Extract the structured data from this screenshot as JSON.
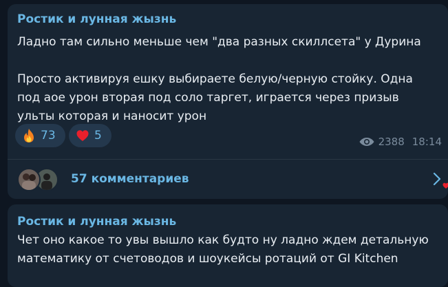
{
  "messages": [
    {
      "author": "Ростик и лунная жызнь",
      "text": "Ладно там сильно меньше чем \"два разных скиллсета\" у Дурина\n\nПросто активируя ешку выбираете белую/черную стойку. Одна\nпод аое урон вторая под соло таргет, играется через призыв\nульты которая и наносит урон",
      "reactions": [
        {
          "emoji": "fire-emoji",
          "count": "73"
        },
        {
          "emoji": "red-heart-emoji",
          "count": "5"
        }
      ],
      "views": "2388",
      "time": "18:14",
      "comments_label": "57 комментариев"
    },
    {
      "author": "Ростик и лунная жызнь",
      "text": "Чет оно какое то увы вышло как будто ну ладно ждем детальную\nматематику от счетоводов и шоукейсы ротаций от GI Kitchen"
    }
  ],
  "colors": {
    "background": "#0e1621",
    "bubble": "#182533",
    "accent": "#6ab7e4",
    "text": "#e9eef3",
    "meta": "#7a8b9c",
    "reaction_bg": "#24384d"
  }
}
